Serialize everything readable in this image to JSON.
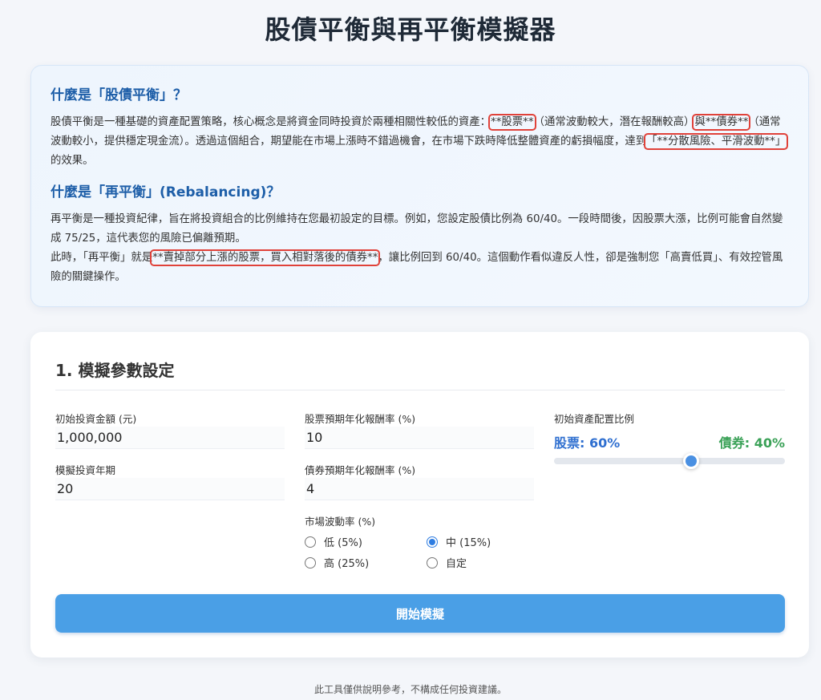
{
  "page": {
    "title": "股債平衡與再平衡模擬器"
  },
  "intro": {
    "heading1": "什麼是「股債平衡」？",
    "p1_a": "股債平衡是一種基礎的資產配置策略，核心概念是將資金同時投資於兩種相關性較低的資產：",
    "p1_hl1": "**股票**",
    "p1_b": "（通常波動較大，潛在報酬較高）",
    "p1_hl2": "與**債券**",
    "p1_c": "（通常波動較小，提供穩定現金流）。透過這個組合，期望能在市場上漲時不錯過機會，在市場下跌時降低整體資產的虧損幅度，達到",
    "p1_hl3": "「**分散風險、平滑波動**」",
    "p1_d": "的效果。",
    "heading2": "什麼是「再平衡」(Rebalancing)？",
    "p2_line1": "再平衡是一種投資紀律，旨在將投資組合的比例維持在您最初設定的目標。例如，您設定股債比例為 60/40。一段時間後，因股票大漲，比例可能會自然變成 75/25，這代表您的風險已偏離預期。",
    "p2_a": "此時，「再平衡」就是",
    "p2_hl": "**賣掉部分上漲的股票，買入相對落後的債券**",
    "p2_b": "，讓比例回到 60/40。這個動作看似違反人性，卻是強制您「高賣低買」、有效控管風險的關鍵操作。"
  },
  "settings": {
    "title": "1. 模擬參數設定",
    "initial_amount_label": "初始投資金額 (元)",
    "initial_amount_value": "1,000,000",
    "years_label": "模擬投資年期",
    "years_value": "20",
    "stock_return_label": "股票預期年化報酬率 (%)",
    "stock_return_value": "10",
    "bond_return_label": "債券預期年化報酬率 (%)",
    "bond_return_value": "4",
    "volatility_label": "市場波動率 (%)",
    "volatility_options": [
      {
        "label": "低 (5%)",
        "checked": false
      },
      {
        "label": "中 (15%)",
        "checked": true
      },
      {
        "label": "高 (25%)",
        "checked": false
      },
      {
        "label": "自定",
        "checked": false
      }
    ],
    "allocation_label": "初始資產配置比例",
    "stock_alloc_text": "股票: 60%",
    "bond_alloc_text": "債券: 40%",
    "stock_fraction": 0.6,
    "start_button": "開始模擬"
  },
  "footer": {
    "disclaimer": "此工具僅供說明參考，不構成任何投資建議。"
  },
  "colors": {
    "accent": "#4a9fe6",
    "stock": "#2f6fd0",
    "bond": "#3aa157",
    "highlight_box": "#e0423a"
  }
}
